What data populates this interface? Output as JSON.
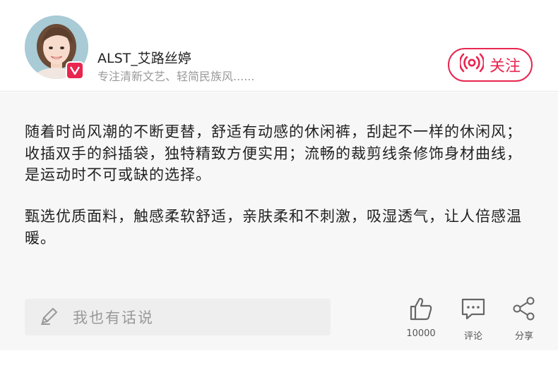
{
  "user": {
    "name": "ALST_艾路丝婷",
    "subtitle": "专注清新文艺、轻简民族风......",
    "avatar_icon": "avatar-portrait",
    "badge_icon": "verified-v-icon"
  },
  "follow": {
    "label": "关注",
    "icon": "broadcast-icon"
  },
  "content": {
    "paragraphs": [
      "随着时尚风潮的不断更替，舒适有动感的休闲裤，刮起不一样的休闲风；收插双手的斜插袋，独特精致方便实用；流畅的裁剪线条修饰身材曲线，是运动时不可或缺的选择。",
      "甄选优质面料，触感柔软舒适，亲肤柔和不刺激，吸湿透气，让人倍感温暖。"
    ]
  },
  "comment": {
    "placeholder": "我也有话说",
    "icon": "pencil-icon"
  },
  "actions": {
    "like": {
      "label": "10000",
      "icon": "thumbs-up-icon"
    },
    "comment": {
      "label": "评论",
      "icon": "comment-icon"
    },
    "share": {
      "label": "分享",
      "icon": "share-icon"
    }
  },
  "colors": {
    "accent": "#e8264f",
    "content_bg": "#f7f7f7",
    "input_bg": "#eeeeee",
    "muted_text": "#999999"
  }
}
